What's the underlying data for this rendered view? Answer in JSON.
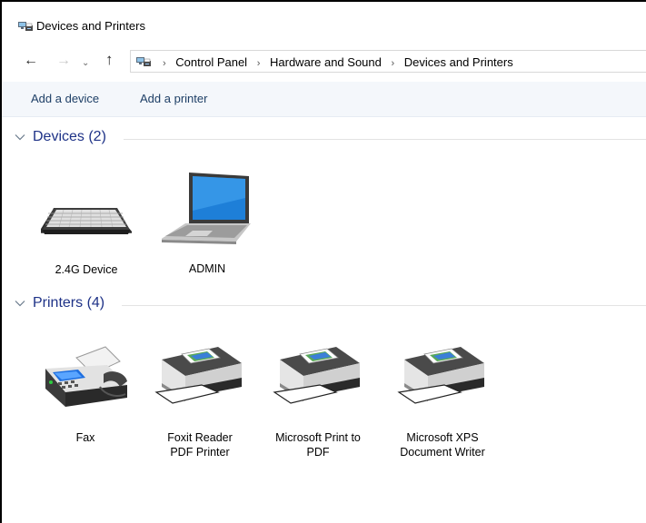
{
  "window": {
    "title": "Devices and Printers"
  },
  "nav": {
    "back_icon": "arrow-left-icon",
    "forward_icon": "arrow-right-icon",
    "recent_icon": "chevron-down-icon",
    "up_icon": "arrow-up-icon",
    "breadcrumb": [
      "Control Panel",
      "Hardware and Sound",
      "Devices and Printers"
    ]
  },
  "commands": {
    "add_device": "Add a device",
    "add_printer": "Add a printer"
  },
  "groups": {
    "devices": {
      "title": "Devices (2)",
      "items": [
        {
          "label": "2.4G Device",
          "icon": "keyboard-icon"
        },
        {
          "label": "ADMIN",
          "icon": "laptop-icon"
        }
      ]
    },
    "printers": {
      "title": "Printers (4)",
      "items": [
        {
          "label": "Fax",
          "icon": "fax-icon"
        },
        {
          "label": "Foxit Reader PDF Printer",
          "icon": "printer-icon"
        },
        {
          "label": "Microsoft Print to PDF",
          "icon": "printer-icon"
        },
        {
          "label": "Microsoft XPS Document Writer",
          "icon": "printer-icon"
        }
      ]
    }
  },
  "colors": {
    "header_text": "#1e3287",
    "command_text": "#1e3f66",
    "command_bar_bg": "#f4f7fb"
  }
}
